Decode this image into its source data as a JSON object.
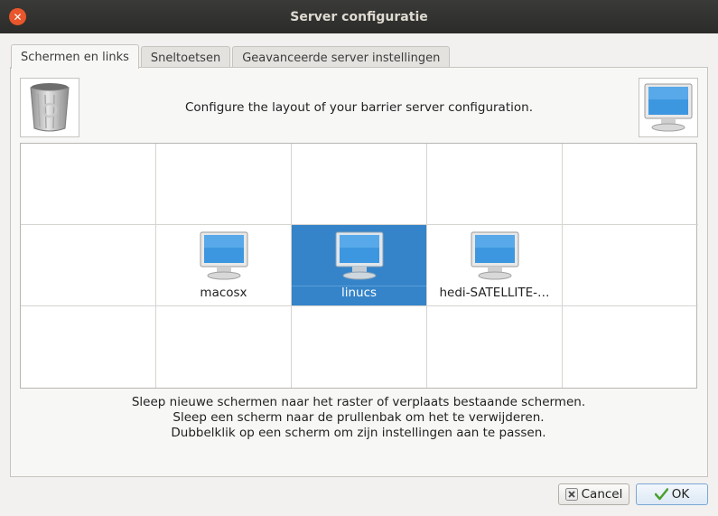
{
  "window": {
    "title": "Server configuratie"
  },
  "tabs": [
    {
      "label": "Schermen en links",
      "active": true
    },
    {
      "label": "Sneltoetsen",
      "active": false
    },
    {
      "label": "Geavanceerde server instellingen",
      "active": false
    }
  ],
  "layout": {
    "description": "Configure the layout of your barrier server configuration.",
    "trash_icon": "trash-icon",
    "new_screen_icon": "monitor-icon"
  },
  "grid": {
    "rows": 3,
    "columns": 5,
    "screens": [
      {
        "name": "macosx",
        "row": 1,
        "col": 1,
        "selected": false
      },
      {
        "name": "linucs",
        "row": 1,
        "col": 2,
        "selected": true
      },
      {
        "name": "hedi-SATELLITE-…",
        "row": 1,
        "col": 3,
        "selected": false
      }
    ]
  },
  "help": {
    "line1": "Sleep nieuwe schermen naar het raster of verplaats bestaande schermen.",
    "line2": "Sleep een scherm naar de prullenbak om het te verwijderen.",
    "line3": "Dubbelklik op een scherm om zijn instellingen aan te passen."
  },
  "buttons": {
    "cancel_label": "Cancel",
    "ok_label": "OK"
  },
  "colors": {
    "selection": "#3584c9",
    "close_button": "#e9562b"
  }
}
